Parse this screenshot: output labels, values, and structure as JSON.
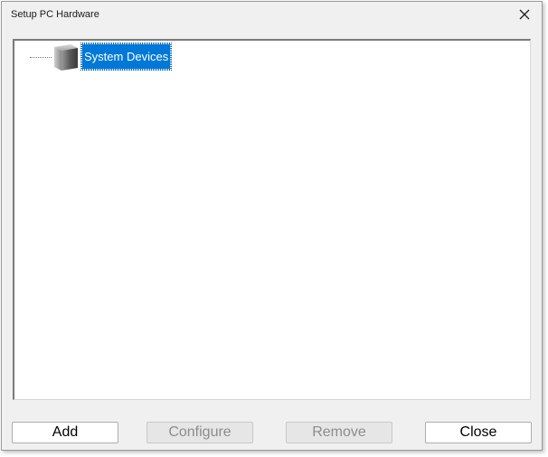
{
  "window": {
    "title": "Setup PC Hardware"
  },
  "tree": {
    "items": [
      {
        "label": "System Devices",
        "icon": "system-devices-icon",
        "selected": true
      }
    ]
  },
  "buttons": {
    "add": "Add",
    "configure": "Configure",
    "remove": "Remove",
    "close": "Close"
  },
  "colors": {
    "selection": "#0078d7",
    "window_bg": "#f0f0f0",
    "panel_bg": "#ffffff",
    "disabled_text": "#8c8c8c"
  }
}
